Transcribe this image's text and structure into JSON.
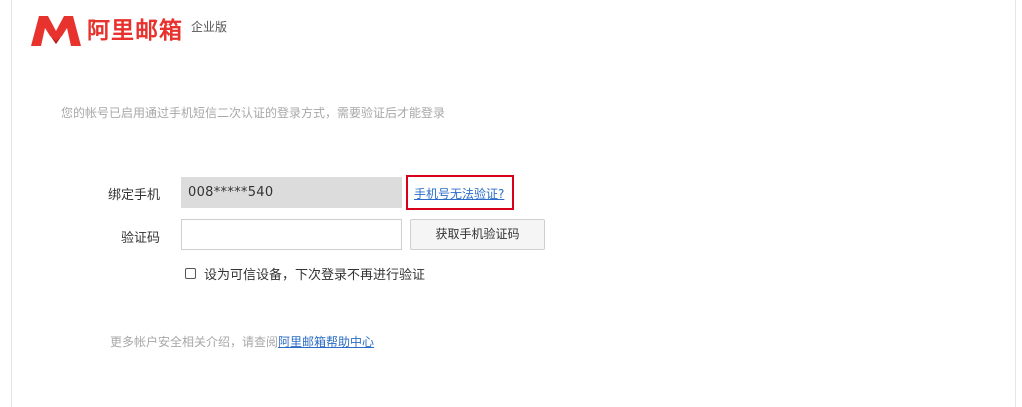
{
  "header": {
    "logo_icon": "mail-m-logo",
    "brand_name": "阿里邮箱",
    "edition": "企业版",
    "brand_color": "#e8322e"
  },
  "notice": "您的帐号已启用通过手机短信二次认证的登录方式，需要验证后才能登录",
  "form": {
    "phone_label": "绑定手机",
    "phone_value": "008*****540",
    "cant_verify_link": "手机号无法验证?",
    "code_label": "验证码",
    "code_value": "",
    "get_code_button": "获取手机验证码",
    "trust_device_label": "设为可信设备，下次登录不再进行验证",
    "trust_device_checked": false
  },
  "footer": {
    "help_text": "更多帐户安全相关介绍，请查阅",
    "help_link": "阿里邮箱帮助中心"
  },
  "colors": {
    "link": "#2a6cc7",
    "highlight_border": "#d9001b",
    "muted_text": "#a8a8a8"
  }
}
